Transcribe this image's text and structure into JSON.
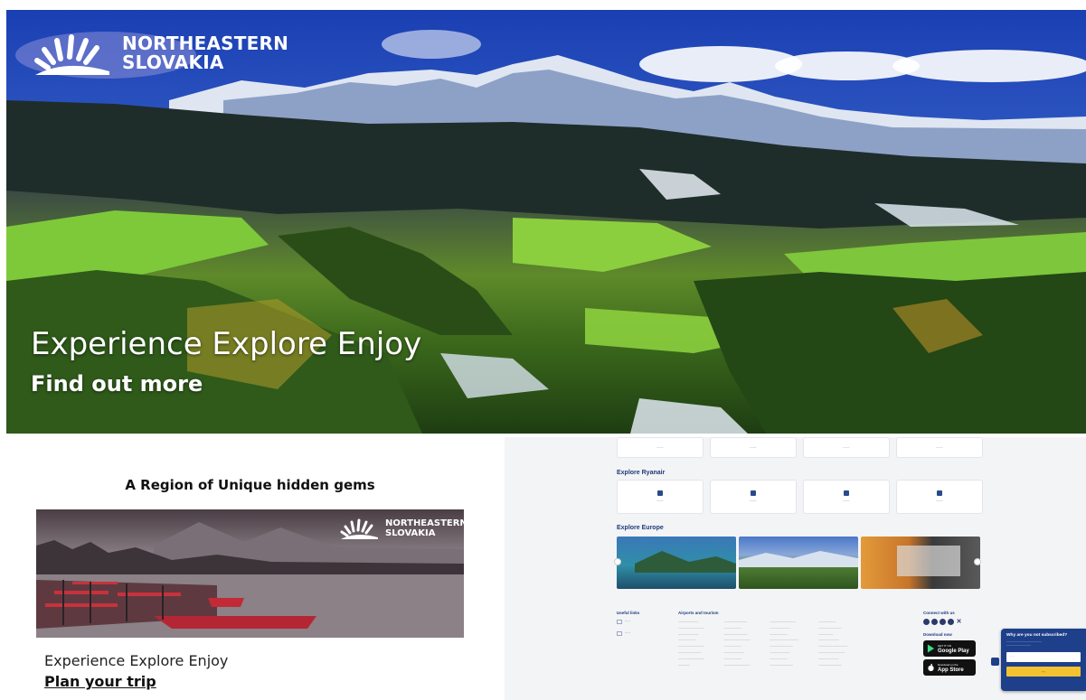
{
  "brand": {
    "line1": "NORTHEASTERN",
    "line2": "SLOVAKIA"
  },
  "hero": {
    "title": "Experience Explore Enjoy",
    "link": "Find out more"
  },
  "region": {
    "heading": "A Region of Unique hidden gems",
    "subtitle": "Experience Explore Enjoy",
    "link": "Plan your trip"
  },
  "screenshot": {
    "sections": {
      "explore_ryanair": "Explore Ryanair",
      "explore_europe": "Explore Europe"
    },
    "footer_headings": {
      "useful_links": "Useful links",
      "airports": "Airports and tourism",
      "connect": "Connect with us",
      "download": "Download now"
    },
    "stores": [
      {
        "small": "GET IT ON",
        "big": "Google Play"
      },
      {
        "small": "Download on the",
        "big": "App Store"
      }
    ],
    "newsletter": {
      "question": "Why are you not subscribed?"
    }
  },
  "colors": {
    "brand_blue": "#1e3f8a",
    "accent_yellow": "#f2c230"
  }
}
